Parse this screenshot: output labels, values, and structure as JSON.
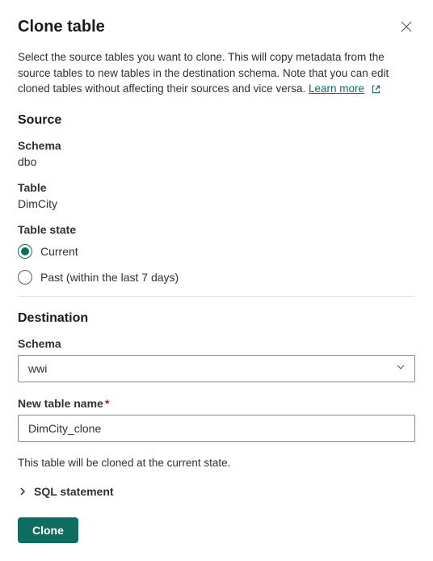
{
  "dialog": {
    "title": "Clone table",
    "description": "Select the source tables you want to clone. This will copy metadata from the source tables to new tables in the destination schema. Note that you can edit cloned tables without affecting their sources and vice versa.",
    "learn_more_label": "Learn more"
  },
  "source": {
    "heading": "Source",
    "schema_label": "Schema",
    "schema_value": "dbo",
    "table_label": "Table",
    "table_value": "DimCity",
    "table_state_label": "Table state",
    "radio_options": [
      {
        "label": "Current",
        "selected": true
      },
      {
        "label": "Past (within the last 7 days)",
        "selected": false
      }
    ]
  },
  "destination": {
    "heading": "Destination",
    "schema_label": "Schema",
    "schema_value": "wwi",
    "new_table_label": "New table name",
    "new_table_required": true,
    "new_table_value": "DimCity_clone"
  },
  "helper": "This table will be cloned at the current state.",
  "expander": {
    "label": "SQL statement"
  },
  "actions": {
    "primary": "Clone"
  }
}
